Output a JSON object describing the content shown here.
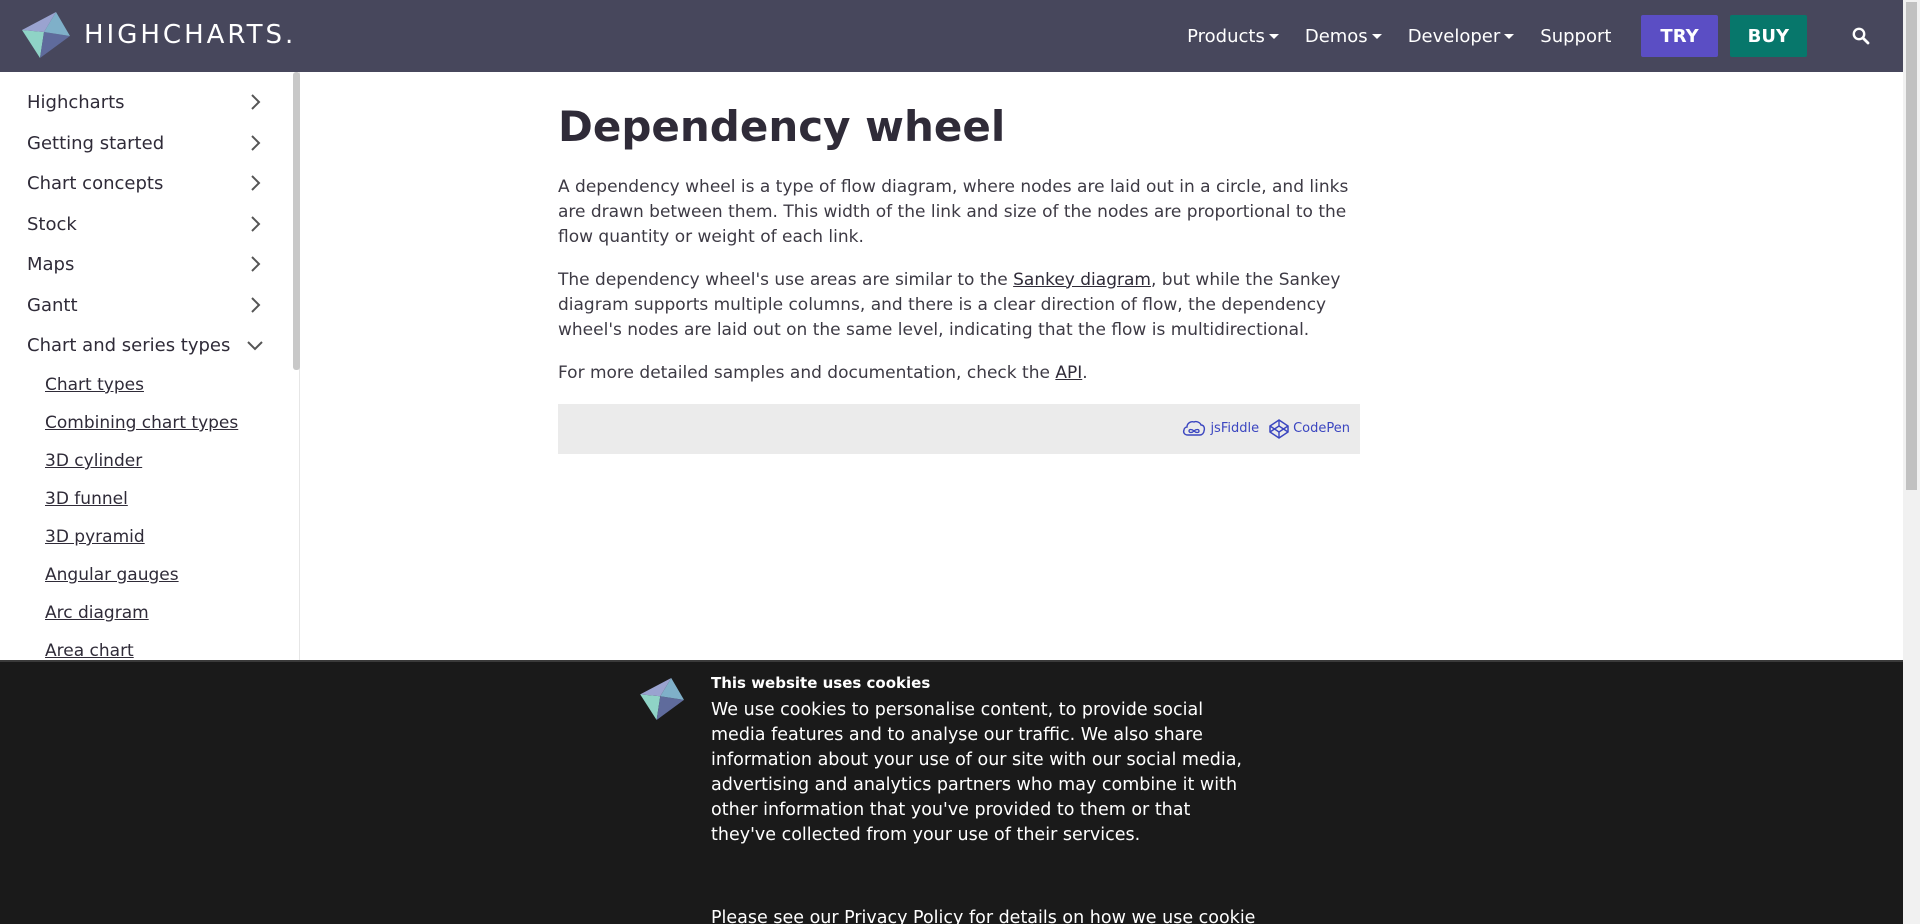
{
  "brand": {
    "name": "HIGHCHARTS."
  },
  "nav": {
    "items": [
      {
        "label": "Products",
        "dropdown": true
      },
      {
        "label": "Demos",
        "dropdown": true
      },
      {
        "label": "Developer",
        "dropdown": true
      },
      {
        "label": "Support",
        "dropdown": false
      }
    ],
    "try_label": "TRY",
    "buy_label": "BUY",
    "search_icon": "search-icon"
  },
  "sidebar": {
    "sections": [
      {
        "label": "Highcharts",
        "expanded": false
      },
      {
        "label": "Getting started",
        "expanded": false
      },
      {
        "label": "Chart concepts",
        "expanded": false
      },
      {
        "label": "Stock",
        "expanded": false
      },
      {
        "label": "Maps",
        "expanded": false
      },
      {
        "label": "Gantt",
        "expanded": false
      },
      {
        "label": "Chart and series types",
        "expanded": true
      }
    ],
    "subitems": [
      "Chart types",
      "Combining chart types",
      "3D cylinder",
      "3D funnel",
      "3D pyramid",
      "Angular gauges",
      "Arc diagram",
      "Area chart"
    ]
  },
  "main": {
    "title": "Dependency wheel",
    "p1": "A dependency wheel is a type of flow diagram, where nodes are laid out in a circle, and links are drawn between them. This width of the link and size of the nodes are proportional to the flow quantity or weight of each link.",
    "p2_before": "The dependency wheel's use areas are similar to the ",
    "p2_link": "Sankey diagram",
    "p2_after": ", but while the Sankey diagram supports multiple columns, and there is a clear direction of flow, the dependency wheel's nodes are laid out on the same level, indicating that the flow is multidirectional.",
    "p3_before": "For more detailed samples and documentation, check the ",
    "p3_link": "API",
    "p3_after": ".",
    "jsfiddle_label": "jsFiddle",
    "codepen_label": "CodePen"
  },
  "cookie": {
    "title": "This website uses cookies",
    "body": "We use cookies to personalise content, to provide social media features and to analyse our traffic. We also share information about your use of our site with our social media, advertising and analytics partners who may combine it with other information that you've provided to them or that they've collected from your use of their services.",
    "body2": "Please see our Privacy Policy for details on how we use cookies, and"
  },
  "colors": {
    "nav_bg": "#47475c",
    "try_bg": "#5b4ec4",
    "buy_bg": "#07776b",
    "link_blue": "#3b46c0",
    "cookie_bg": "#1a1a1a"
  }
}
